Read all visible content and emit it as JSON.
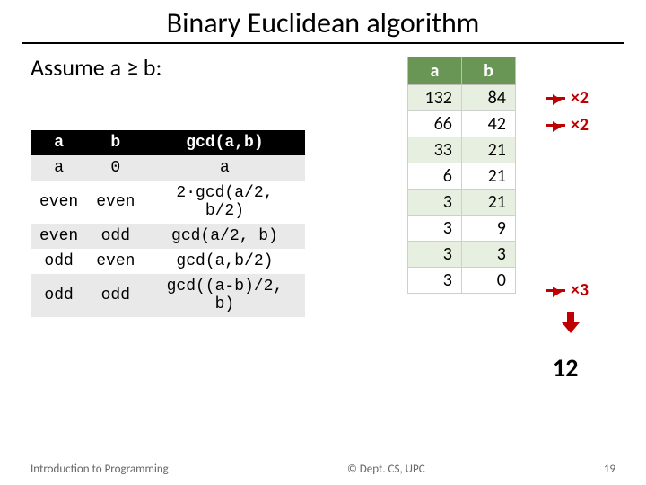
{
  "title": "Binary Euclidean algorithm",
  "assume": "Assume a ≥ b:",
  "rules": {
    "headers": {
      "a": "a",
      "b": "b",
      "g": "gcd(a,b)"
    },
    "rows": [
      {
        "a": "a",
        "b": "0",
        "g": "a"
      },
      {
        "a": "even",
        "b": "even",
        "g": "2·gcd(a/2, b/2)"
      },
      {
        "a": "even",
        "b": "odd",
        "g": "gcd(a/2, b)"
      },
      {
        "a": "odd",
        "b": "even",
        "g": "gcd(a,b/2)"
      },
      {
        "a": "odd",
        "b": "odd",
        "g": "gcd((a-b)/2, b)"
      }
    ]
  },
  "trace": {
    "headers": {
      "a": "a",
      "b": "b"
    },
    "rows": [
      {
        "a": "132",
        "b": "84"
      },
      {
        "a": "66",
        "b": "42"
      },
      {
        "a": "33",
        "b": "21"
      },
      {
        "a": "6",
        "b": "21"
      },
      {
        "a": "3",
        "b": "21"
      },
      {
        "a": "3",
        "b": "9"
      },
      {
        "a": "3",
        "b": "3"
      },
      {
        "a": "3",
        "b": "0"
      }
    ]
  },
  "annotations": {
    "x2a": "×2",
    "x2b": "×2",
    "x3": "×3"
  },
  "result": "12",
  "footer": {
    "left": "Introduction to Programming",
    "center": "© Dept. CS, UPC",
    "right": "19"
  }
}
